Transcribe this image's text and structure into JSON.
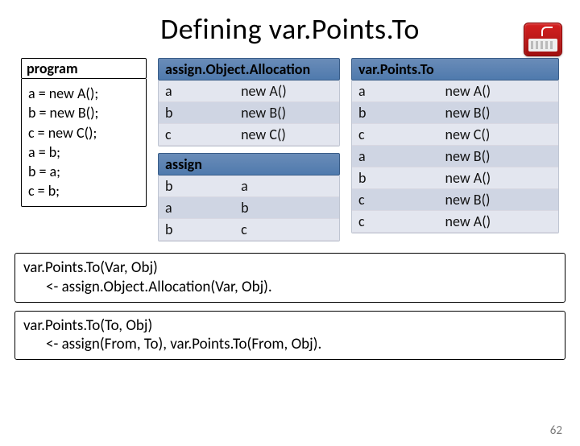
{
  "title": "Defining var.Points.To",
  "program": {
    "header": "program",
    "lines": [
      "a = new A();",
      "b = new B();",
      "c = new C();",
      "a = b;",
      "b = a;",
      "c = b;"
    ]
  },
  "alloc": {
    "header": "assign.Object.Allocation",
    "rows": [
      {
        "l": "a",
        "r": "new A()"
      },
      {
        "l": "b",
        "r": "new B()"
      },
      {
        "l": "c",
        "r": "new C()"
      }
    ]
  },
  "assign": {
    "header": "assign",
    "rows": [
      {
        "l": "b",
        "r": "a"
      },
      {
        "l": "a",
        "r": "b"
      },
      {
        "l": "b",
        "r": "c"
      }
    ]
  },
  "vpt": {
    "header": "var.Points.To",
    "rows": [
      {
        "l": "a",
        "r": "new A()"
      },
      {
        "l": "b",
        "r": "new B()"
      },
      {
        "l": "c",
        "r": "new C()"
      },
      {
        "l": "a",
        "r": "new B()"
      },
      {
        "l": "b",
        "r": "new A()"
      },
      {
        "l": "c",
        "r": "new B()"
      },
      {
        "l": "c",
        "r": "new A()"
      }
    ]
  },
  "rules": {
    "r1a": "var.Points.To(Var, Obj)",
    "r1b": "<- assign.Object.Allocation(Var, Obj).",
    "r2a": "var.Points.To(To, Obj)",
    "r2b": "<- assign(From, To), var.Points.To(From, Obj)."
  },
  "page": "62"
}
